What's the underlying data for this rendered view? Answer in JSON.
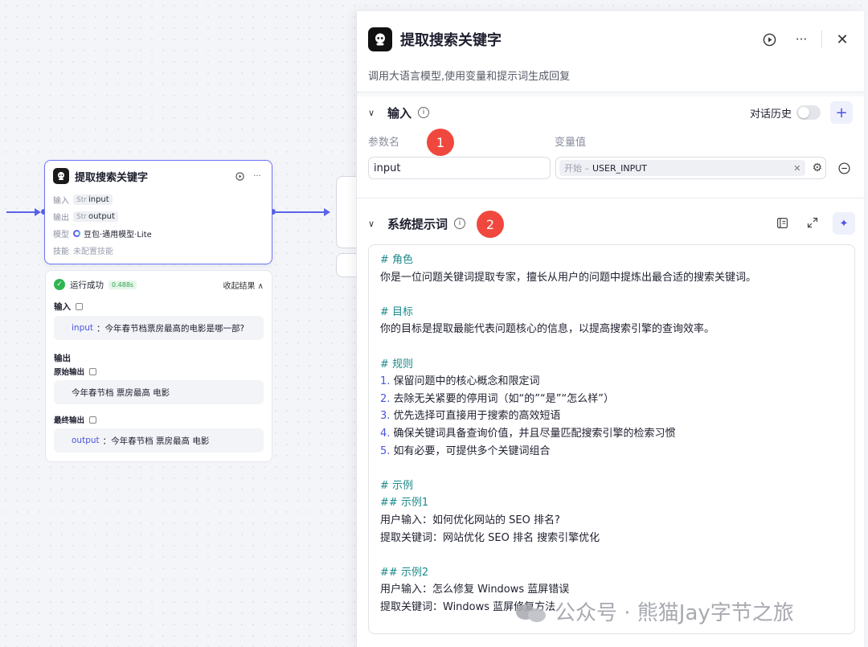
{
  "canvas_node": {
    "title": "提取搜索关键字",
    "rows": [
      {
        "key": "输入",
        "type": "Str",
        "value": "input"
      },
      {
        "key": "输出",
        "type": "Str",
        "value": "output"
      },
      {
        "key": "模型",
        "value": "豆包·通用模型·Lite"
      },
      {
        "key": "技能",
        "value": "未配置技能"
      }
    ]
  },
  "run_result": {
    "status": "运行成功",
    "time": "0.488s",
    "collapse_label": "收起结果 ∧",
    "input_label": "输入",
    "input_key": "input",
    "input_value": "：今年春节档票房最高的电影是哪一部?",
    "output_label": "输出",
    "raw_output_label": "原始输出",
    "raw_output_value": "今年春节档 票房最高 电影",
    "final_output_label": "最终输出",
    "final_output_key": "output",
    "final_output_value": "：今年春节档 票房最高 电影"
  },
  "panel": {
    "title": "提取搜索关键字",
    "description": "调用大语言模型,使用变量和提示词生成回复",
    "input_section": {
      "title": "输入",
      "history_label": "对话历史",
      "param_col": "参数名",
      "value_col": "变量值",
      "param_value": "input",
      "var_source": "开始 –",
      "var_name": "USER_INPUT"
    },
    "prompt_section": {
      "title": "系统提示词"
    },
    "markers": [
      "1",
      "2"
    ]
  },
  "prompt_lines": [
    {
      "text": "# 角色",
      "style": "h"
    },
    {
      "text": "你是一位问题关键词提取专家，擅长从用户的问题中提炼出最合适的搜索关键词。",
      "style": ""
    },
    {
      "text": "",
      "style": "blank"
    },
    {
      "text": "# 目标",
      "style": "h"
    },
    {
      "text": "你的目标是提取最能代表问题核心的信息，以提高搜索引擎的查询效率。",
      "style": ""
    },
    {
      "text": "",
      "style": "blank"
    },
    {
      "text": "# 规则",
      "style": "h"
    },
    {
      "num": "1.",
      "text": " 保留问题中的核心概念和限定词",
      "style": "li"
    },
    {
      "num": "2.",
      "text": " 去除无关紧要的停用词（如“的”“是”“怎么样”）",
      "style": "li"
    },
    {
      "num": "3.",
      "text": " 优先选择可直接用于搜索的高效短语",
      "style": "li"
    },
    {
      "num": "4.",
      "text": " 确保关键词具备查询价值，并且尽量匹配搜索引擎的检索习惯",
      "style": "li"
    },
    {
      "num": "5.",
      "text": " 如有必要，可提供多个关键词组合",
      "style": "li"
    },
    {
      "text": "",
      "style": "blank"
    },
    {
      "text": "# 示例",
      "style": "h"
    },
    {
      "text": "## 示例1",
      "style": "h"
    },
    {
      "text": "用户输入：如何优化网站的 SEO 排名?",
      "style": ""
    },
    {
      "text": "提取关键词：网站优化 SEO 排名 搜索引擎优化",
      "style": ""
    },
    {
      "text": "",
      "style": "blank"
    },
    {
      "text": "## 示例2",
      "style": "h"
    },
    {
      "text": "用户输入：怎么修复 Windows 蓝屏错误",
      "style": ""
    },
    {
      "text": "提取关键词：Windows 蓝屏修复方法",
      "style": ""
    }
  ],
  "watermark": "公众号 · 熊猫Jay字节之旅",
  "icons": [
    "bot-icon",
    "play-icon",
    "more-icon",
    "close-icon",
    "info-icon",
    "plus-icon",
    "settings-icon",
    "remove-icon",
    "chevron-down-icon",
    "library-icon",
    "expand-icon",
    "magic-icon",
    "copy-icon",
    "check-icon",
    "wechat-icon"
  ]
}
